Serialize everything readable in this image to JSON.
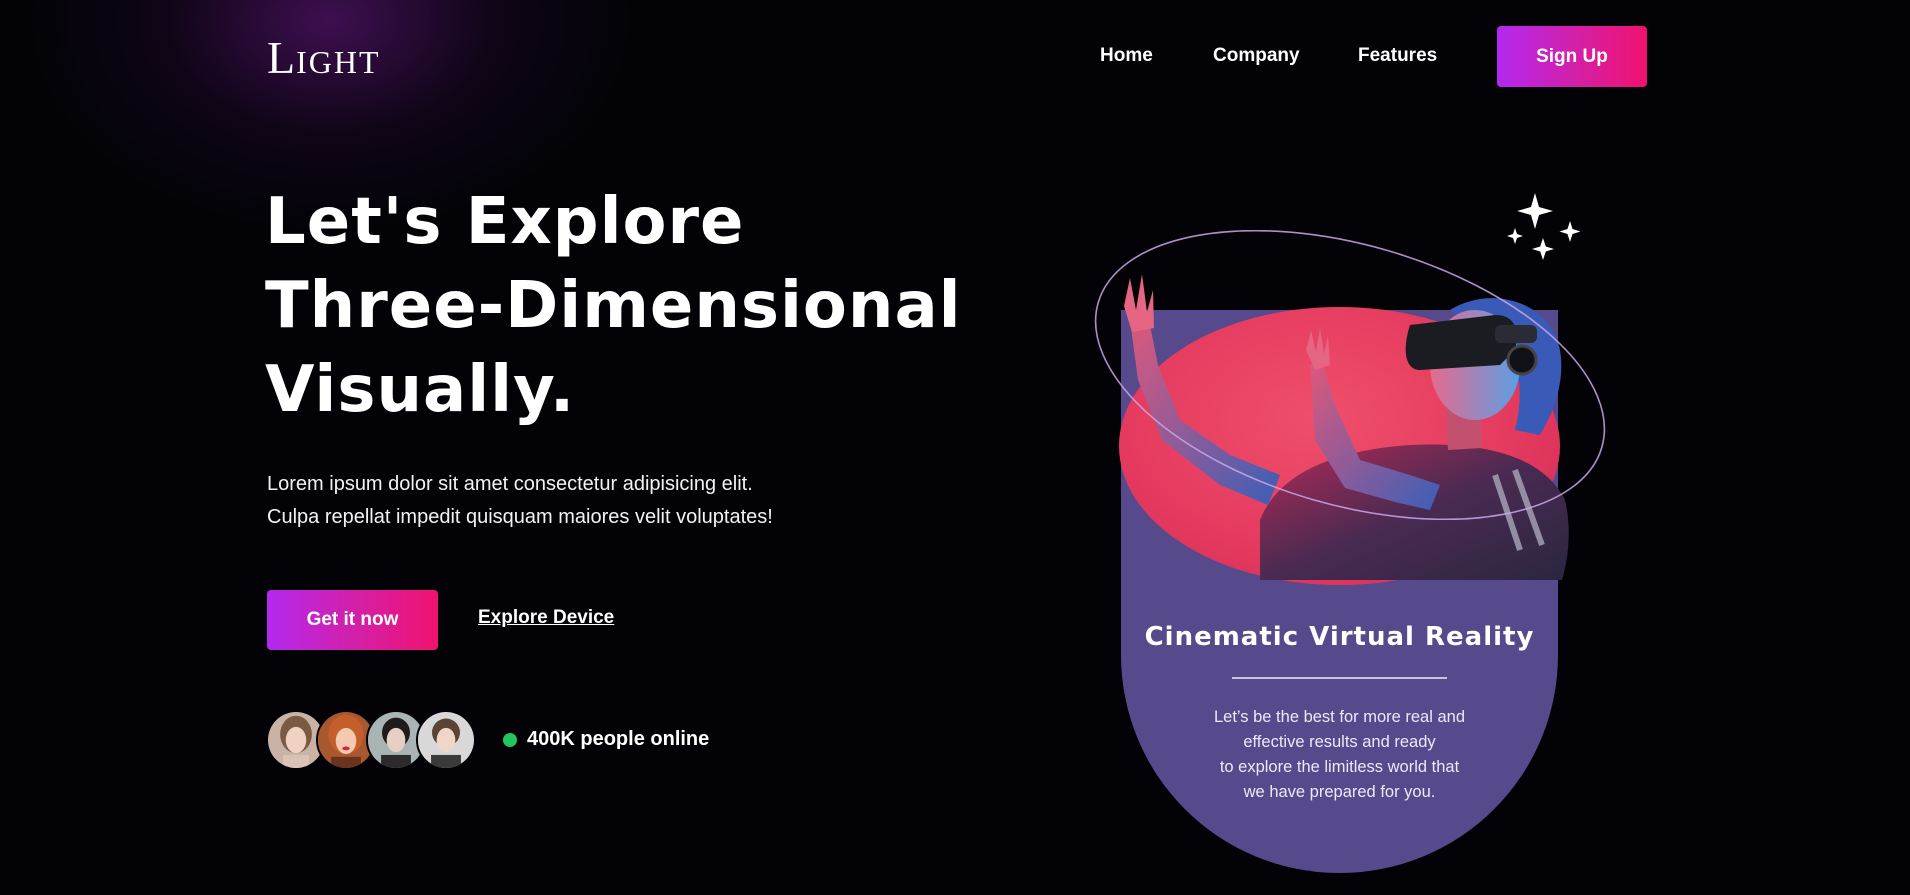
{
  "header": {
    "logo_first": "L",
    "logo_rest": "ight",
    "nav": {
      "home": "Home",
      "company": "Company",
      "features": "Features"
    },
    "signup_label": "Sign Up"
  },
  "hero": {
    "title_lines": [
      "Let's Explore",
      "Three-Dimensional",
      "Visually."
    ],
    "description_lines": [
      "Lorem ipsum dolor sit amet consectetur adipisicing elit.",
      "Culpa repellat impedit quisquam maiores velit voluptates!"
    ],
    "primary_cta": "Get it now",
    "secondary_cta": "Explore Device",
    "online_count": "400K people online"
  },
  "card": {
    "title": "Cinematic Virtual Reality",
    "text_lines": [
      "Let’s be the best for more real and",
      "effective results and ready",
      "to explore the limitless world that",
      "we have prepared for you."
    ]
  },
  "colors": {
    "background": "#030307",
    "gradient_start": "#b329f0",
    "gradient_end": "#f0126e",
    "card_purple": "#564a8c",
    "card_pink": "#e4395e",
    "online_green": "#22c55e"
  },
  "icons": {
    "sparkles": "sparkles-icon",
    "online": "status-dot-icon"
  }
}
